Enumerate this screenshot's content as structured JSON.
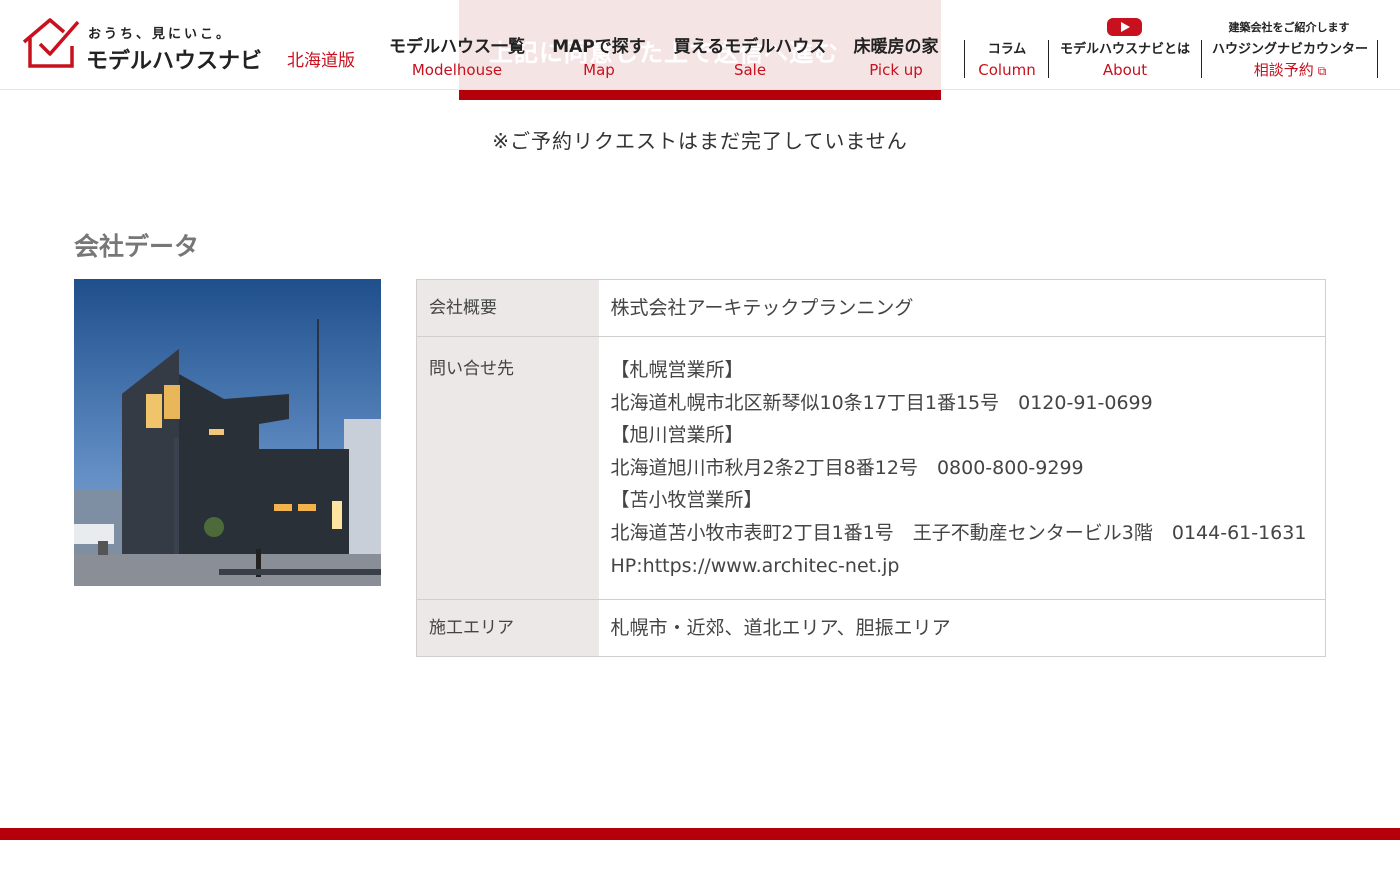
{
  "colors": {
    "brand_red": "#c8101e",
    "footer_red": "#b5000b",
    "table_header_bg": "#ece8e8"
  },
  "banner": {
    "text": "上記に同意した上で送信へ進む"
  },
  "logo": {
    "tagline": "おうち、見にいこ。",
    "name": "モデルハウスナビ",
    "region": "北海道版",
    "icon": "house-check-icon"
  },
  "nav": {
    "main": [
      {
        "jp": "モデルハウス一覧",
        "en": "Modelhouse"
      },
      {
        "jp": "MAPで探す",
        "en": "Map"
      },
      {
        "jp": "買えるモデルハウス",
        "en": "Sale"
      },
      {
        "jp": "床暖房の家",
        "en": "Pick up"
      }
    ],
    "column": {
      "jp": "コラム",
      "en": "Column"
    },
    "about": {
      "jp": "モデルハウスナビとは",
      "en": "About",
      "icon": "youtube-icon"
    },
    "counter": {
      "intro": "建築会社をご紹介します",
      "jp": "ハウジングナビカウンター",
      "en": "相談予約",
      "icon": "external-link-icon"
    }
  },
  "notice": "※ご予約リクエストはまだ完了していません",
  "company": {
    "section_title": "会社データ",
    "photo_alt": "dark modern house at dusk",
    "rows": [
      {
        "label": "会社概要",
        "lines": [
          "株式会社アーキテックプランニング"
        ]
      },
      {
        "label": "問い合せ先",
        "lines": [
          "【札幌営業所】",
          "北海道札幌市北区新琴似10条17丁目1番15号　0120-91-0699",
          "【旭川営業所】",
          "北海道旭川市秋月2条2丁目8番12号　0800-800-9299",
          "【苫小牧営業所】",
          "北海道苫小牧市表町2丁目1番1号　王子不動産センタービル3階　0144-61-1631",
          "HP:https://www.architec-net.jp"
        ]
      },
      {
        "label": "施工エリア",
        "lines": [
          "札幌市・近郊、道北エリア、胆振エリア"
        ]
      }
    ]
  }
}
